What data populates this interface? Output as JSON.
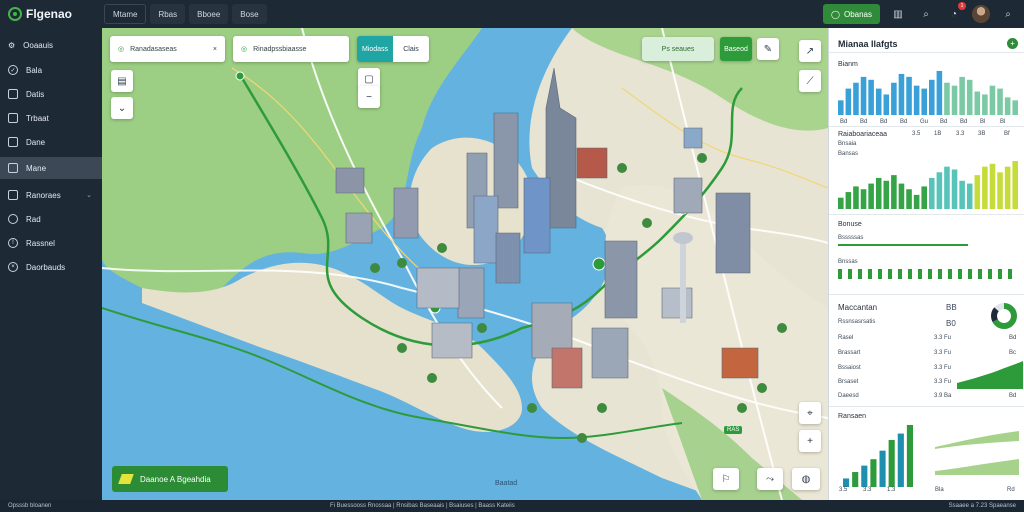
{
  "app": {
    "name": "Flgenao"
  },
  "topnav": [
    "Mtame",
    "Rbas",
    "Bboee",
    "Bose"
  ],
  "top_right": {
    "primary_button": "Obanas"
  },
  "sidebar": {
    "items": [
      {
        "label": "Ooaauis"
      },
      {
        "label": "Bala"
      },
      {
        "label": "Datis"
      },
      {
        "label": "Trbaat"
      },
      {
        "label": "Dane"
      },
      {
        "label": "Mane"
      },
      {
        "label": "Ranoraes"
      },
      {
        "label": "Rad"
      },
      {
        "label": "Rassnel"
      },
      {
        "label": "Daorbauds"
      }
    ]
  },
  "map": {
    "search": {
      "label": "Ranadasaseas"
    },
    "route_search": {
      "label": "Rinadpssbiaasse"
    },
    "mode_buttons": [
      "Miodass",
      "Clais"
    ],
    "status_badge": "Ps seaues",
    "active_badge": "Baseod",
    "legend": "Daanoe A Bgeahdia",
    "scale": "Baatad",
    "road_labels": [
      "RAS"
    ]
  },
  "panel": {
    "title": "Mianaa Ilafgts",
    "sections": [
      {
        "label": "Bianm",
        "ticks": [
          "Bd",
          "Bd",
          "Bd",
          "Bd",
          "Gu",
          "Bd",
          "Bd",
          "Bl",
          "Bl"
        ]
      },
      {
        "label": "Raiaboariaceaa",
        "values": [
          "3.5",
          "1B",
          "3.3",
          "3B",
          "Bf"
        ],
        "sub": [
          "Bnsaia",
          "Bansas"
        ]
      },
      {
        "label": "Bonuse",
        "rows": [
          "Bsssssas",
          "Bnssas"
        ]
      },
      {
        "label": "Maccantan",
        "value_a": "BB",
        "value_b": "B0",
        "rows": [
          {
            "name": "Rssnsasrsatis",
            "a": "",
            "b": ""
          },
          {
            "name": "Rasel",
            "a": "3.3 Fu",
            "b": "Bd"
          },
          {
            "name": "Brassart",
            "a": "3.3 Fu",
            "b": "Bc"
          },
          {
            "name": "Bssaiost",
            "a": "3.3 Fu",
            "b": ""
          },
          {
            "name": "Brsaset",
            "a": "3.3 Fu",
            "b": ""
          },
          {
            "name": "Daeesd",
            "a": "3.9 Ba",
            "b": "Bd"
          }
        ]
      },
      {
        "label": "Ransaen",
        "ticks": [
          "3.5",
          "3.3",
          "1.3",
          "Bla",
          "Rd"
        ]
      }
    ]
  },
  "footer": {
    "left": "Opsssb bloanen",
    "center": "Fi  Buessooss Rnossaa  |  Rnsibas  Baseaais  |  Bsaiuses  |  Baass Kateiis",
    "right": "Ssaaee a 7.23 Spaeanse"
  },
  "chart_data": [
    {
      "type": "bar",
      "title": "Bianm",
      "categories": [
        "Bd",
        "Bd",
        "Bd",
        "Bd",
        "Gu",
        "Bd",
        "Bd",
        "Bl",
        "Bl"
      ],
      "series": [
        {
          "values": [
            10,
            18,
            22,
            26,
            24,
            18,
            14,
            22,
            28,
            26,
            20,
            18,
            24,
            30,
            22,
            20,
            26,
            24,
            16,
            14,
            20,
            18,
            12,
            10
          ]
        }
      ]
    },
    {
      "type": "bar",
      "title": "Raiaboariaceaa",
      "series": [
        {
          "values": [
            8,
            12,
            16,
            14,
            18,
            22,
            20,
            24,
            18,
            14,
            10,
            16,
            22,
            26,
            30,
            28,
            20,
            18,
            24,
            30,
            32,
            26,
            30,
            34
          ]
        }
      ]
    },
    {
      "type": "bar",
      "title": "Ransaen",
      "series": [
        {
          "values": [
            8,
            14,
            20,
            26,
            34,
            44,
            50,
            58
          ]
        }
      ]
    }
  ]
}
